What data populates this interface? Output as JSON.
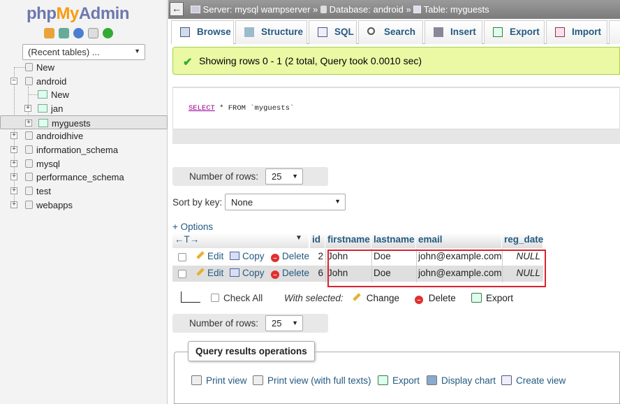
{
  "logo": {
    "php": "php",
    "my": "My",
    "admin": "Admin"
  },
  "navigation": {
    "recent_tables": "(Recent tables) ...",
    "tree": [
      {
        "label": "New",
        "level": 0
      },
      {
        "label": "android",
        "level": 0
      },
      {
        "label": "New",
        "level": 1
      },
      {
        "label": "jan",
        "level": 1
      },
      {
        "label": "myguests",
        "level": 1,
        "selected": true
      },
      {
        "label": "androidhive",
        "level": 0
      },
      {
        "label": "information_schema",
        "level": 0
      },
      {
        "label": "mysql",
        "level": 0
      },
      {
        "label": "performance_schema",
        "level": 0
      },
      {
        "label": "test",
        "level": 0
      },
      {
        "label": "webapps",
        "level": 0
      }
    ]
  },
  "breadcrumb": {
    "server": "Server: mysql wampserver",
    "sep1": "»",
    "database": "Database: android",
    "sep2": "»",
    "table": "Table: myguests"
  },
  "tabs": [
    "Browse",
    "Structure",
    "SQL",
    "Search",
    "Insert",
    "Export",
    "Import"
  ],
  "success_message": "Showing rows 0 - 1 (2 total, Query took 0.0010 sec)",
  "sql": {
    "select": "SELECT",
    "rest": " * FROM `myguests`"
  },
  "number_of_rows": {
    "label": "Number of rows:",
    "value": "25"
  },
  "sort_by_key": {
    "label": "Sort by key:",
    "value": "None"
  },
  "options_link": "+ Options",
  "table": {
    "columns": [
      "id",
      "firstname",
      "lastname",
      "email",
      "reg_date"
    ],
    "rows": [
      {
        "id": "2",
        "firstname": "John",
        "lastname": "Doe",
        "email": "john@example.com",
        "reg_date": "NULL"
      },
      {
        "id": "6",
        "firstname": "John",
        "lastname": "Doe",
        "email": "john@example.com",
        "reg_date": "NULL"
      }
    ],
    "row_actions": {
      "edit": "Edit",
      "copy": "Copy",
      "delete": "Delete"
    }
  },
  "bulk": {
    "check_all": "Check All",
    "with_selected": "With selected:",
    "change": "Change",
    "delete": "Delete",
    "export": "Export"
  },
  "query_results_operations": {
    "title": "Query results operations",
    "items": [
      "Print view",
      "Print view (with full texts)",
      "Export",
      "Display chart",
      "Create view"
    ]
  }
}
